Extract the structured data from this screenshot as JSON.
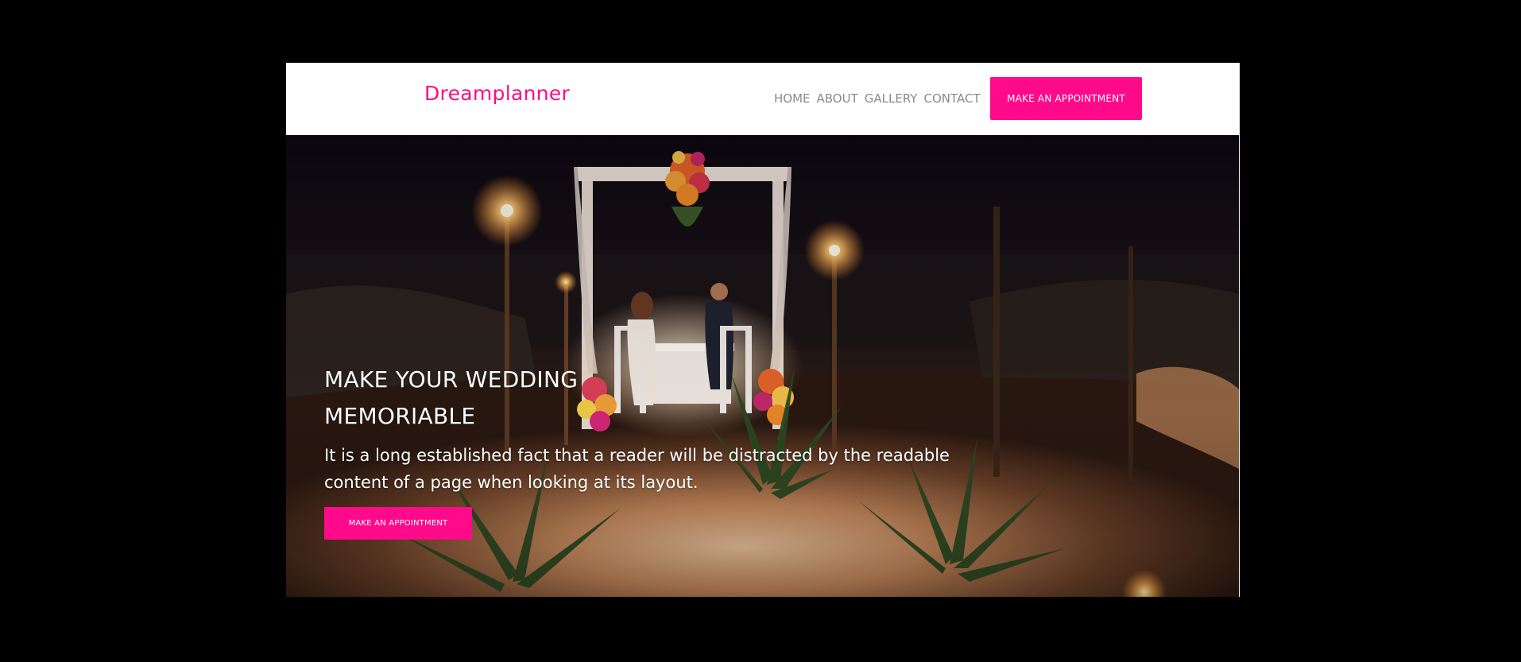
{
  "brand": {
    "name": "Dreamplanner",
    "color": "#ff0a8a"
  },
  "nav": {
    "links": [
      "HOME",
      "ABOUT",
      "GALLERY",
      "CONTACT"
    ],
    "cta_label": "MAKE AN APPOINTMENT"
  },
  "hero": {
    "title": "MAKE YOUR WEDDING MEMORIABLE",
    "text": "It is a long established fact that a reader will be distracted by the readable content of a page when looking at its layout.",
    "cta_label": "MAKE AN APPOINTMENT",
    "image_subject": "beach-wedding-dinner-photo"
  },
  "colors": {
    "accent": "#ff0a8a",
    "nav_text": "#8a8a8a",
    "backdrop": "#000000"
  }
}
